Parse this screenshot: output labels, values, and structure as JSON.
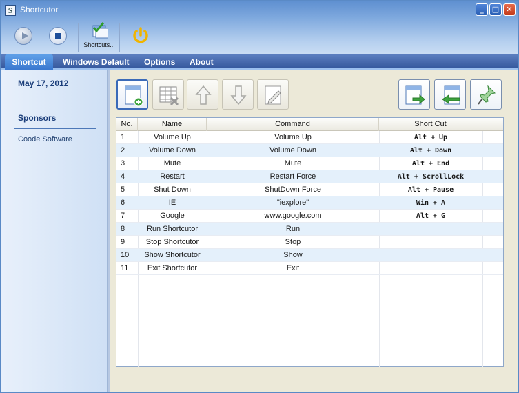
{
  "window": {
    "title": "Shortcutor",
    "app_icon_letter": "S",
    "minimize_glyph": "_",
    "maximize_glyph": "□",
    "close_glyph": "✕"
  },
  "toolbar": {
    "shortcuts_label": "Shortcuts..."
  },
  "tabs": [
    {
      "label": "Shortcut",
      "active": true
    },
    {
      "label": "Windows Default",
      "active": false
    },
    {
      "label": "Options",
      "active": false
    },
    {
      "label": "About",
      "active": false
    }
  ],
  "sidebar": {
    "date": "May 17, 2012",
    "sponsors_heading": "Sponsors",
    "sponsor_link": "Coode Software"
  },
  "table": {
    "columns": [
      "No.",
      "Name",
      "Command",
      "Short Cut"
    ],
    "rows": [
      {
        "no": "1",
        "name": "Volume Up",
        "command": "Volume Up",
        "shortcut": "Alt + Up"
      },
      {
        "no": "2",
        "name": "Volume Down",
        "command": "Volume Down",
        "shortcut": "Alt + Down"
      },
      {
        "no": "3",
        "name": "Mute",
        "command": "Mute",
        "shortcut": "Alt + End"
      },
      {
        "no": "4",
        "name": "Restart",
        "command": "Restart Force",
        "shortcut": "Alt + ScrollLock"
      },
      {
        "no": "5",
        "name": "Shut Down",
        "command": "ShutDown Force",
        "shortcut": "Alt + Pause"
      },
      {
        "no": "6",
        "name": "IE",
        "command": "\"iexplore\"",
        "shortcut": "Win + A"
      },
      {
        "no": "7",
        "name": "Google",
        "command": "www.google.com",
        "shortcut": "Alt + G"
      },
      {
        "no": "8",
        "name": "Run Shortcutor",
        "command": "Run",
        "shortcut": ""
      },
      {
        "no": "9",
        "name": "Stop Shortcutor",
        "command": "Stop",
        "shortcut": ""
      },
      {
        "no": "10",
        "name": "Show Shortcutor",
        "command": "Show",
        "shortcut": ""
      },
      {
        "no": "11",
        "name": "Exit Shortcutor",
        "command": "Exit",
        "shortcut": ""
      }
    ]
  },
  "colors": {
    "accent": "#3a78cf",
    "tab_bar": "#35589d",
    "alt_row": "#e4f0fb",
    "power_icon": "#f0b400"
  },
  "icons": {
    "play": "play-icon",
    "stop": "stop-icon",
    "shortcuts": "shortcuts-icon",
    "power": "power-icon",
    "add": "add-shortcut-icon",
    "delete": "delete-shortcut-icon",
    "up": "move-up-icon",
    "down": "move-down-icon",
    "edit": "edit-shortcut-icon",
    "export": "export-icon",
    "import": "import-icon",
    "pin": "pin-icon"
  }
}
